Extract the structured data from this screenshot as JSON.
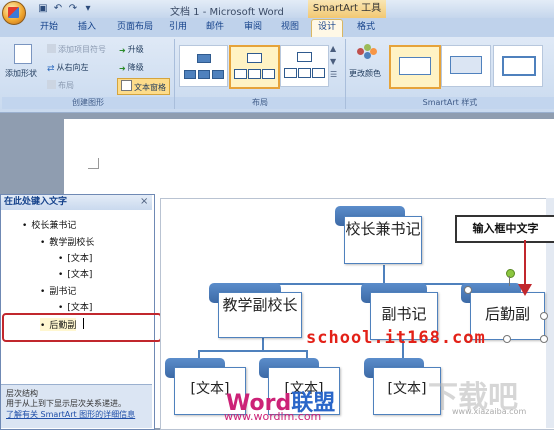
{
  "window": {
    "title": "文档 1 - Microsoft Word",
    "context_tab": "SmartArt 工具"
  },
  "tabs": [
    "开始",
    "插入",
    "页面布局",
    "引用",
    "邮件",
    "审阅",
    "视图",
    "设计",
    "格式"
  ],
  "ribbon": {
    "create_group": {
      "label": "创建图形",
      "add_shape": "添加形状",
      "add_bullet": "添加项目符号",
      "right_to_left": "从右向左",
      "layout": "布局",
      "promote": "升级",
      "demote": "降级",
      "text_pane": "文本窗格"
    },
    "layout_group": {
      "label": "布局"
    },
    "styles_group": {
      "label": "SmartArt 样式",
      "change_colors": "更改颜色"
    }
  },
  "text_pane": {
    "title": "在此处键入文字",
    "items": [
      "校长兼书记",
      "教学副校长",
      "[文本]",
      "[文本]",
      "副书记",
      "[文本]",
      "后勤副"
    ],
    "footer_title": "层次结构",
    "footer_desc": "用于从上到下显示层次关系递进。",
    "footer_link": "了解有关 SmartArt 图形的详细信息"
  },
  "diagram": {
    "top": "校长兼书记",
    "level2": [
      "教学副校长",
      "副书记",
      "后勤副"
    ],
    "level3": [
      "[文本]",
      "[文本]",
      "[文本]"
    ]
  },
  "annotation": {
    "callout": "输入框中文字"
  },
  "watermarks": {
    "school": "school.it168.com",
    "brand_a": "Word",
    "brand_b": "联盟",
    "url": "www.wordlm.com",
    "logo": "下载吧",
    "logo_url": "www.xiazaiba.com"
  },
  "colors": {
    "accent": "#4f81bd",
    "highlight": "#c1272d"
  }
}
